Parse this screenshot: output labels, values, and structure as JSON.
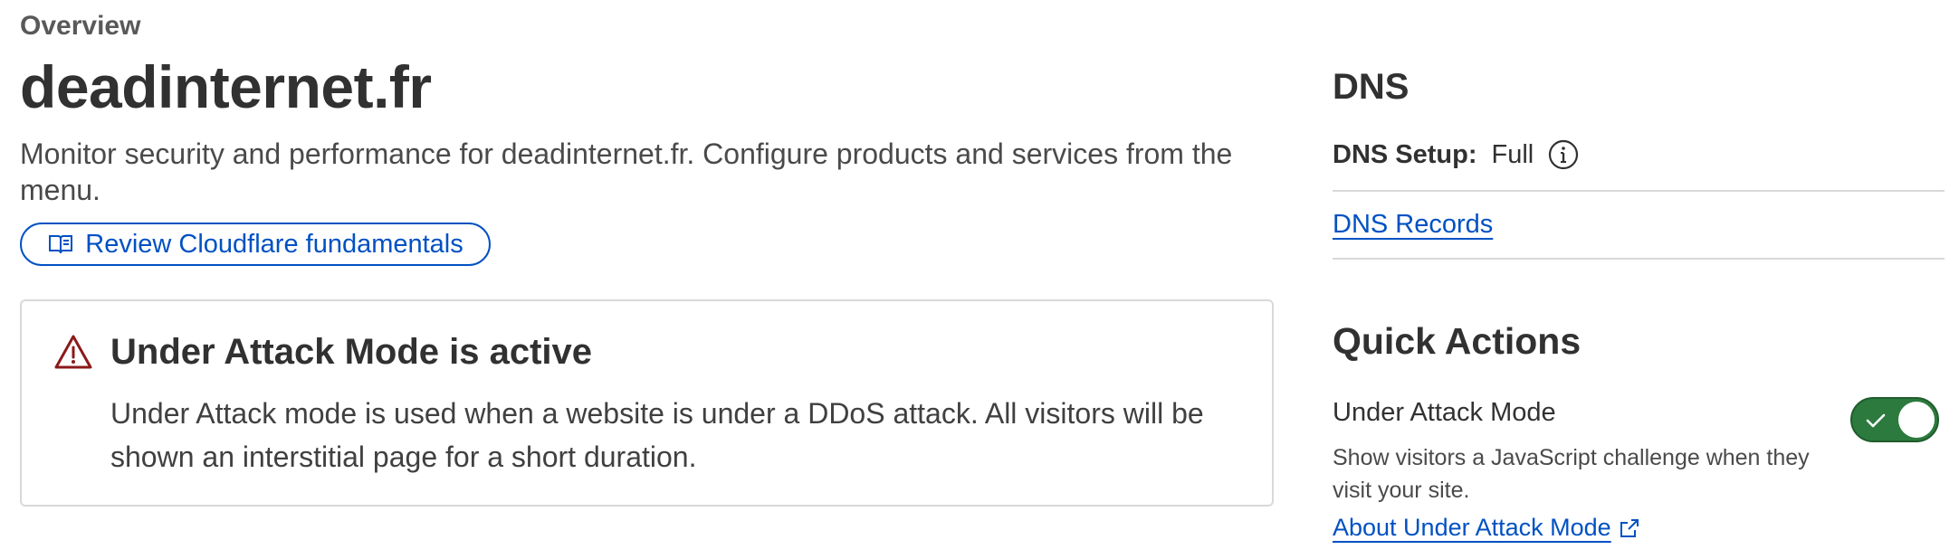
{
  "overview": {
    "eyebrow": "Overview",
    "title": "deadinternet.fr",
    "description": "Monitor security and performance for deadinternet.fr. Configure products and services from the menu.",
    "review_button": {
      "label": "Review Cloudflare fundamentals",
      "icon": "book-icon"
    }
  },
  "alert": {
    "icon": "warning-icon",
    "title": "Under Attack Mode is active",
    "body": "Under Attack mode is used when a website is under a DDoS attack. All visitors will be shown an interstitial page for a short duration."
  },
  "dns": {
    "heading": "DNS",
    "setup_label": "DNS Setup:",
    "setup_value": "Full",
    "info_icon": "info-icon",
    "records_link": "DNS Records"
  },
  "quick_actions": {
    "heading": "Quick Actions",
    "under_attack": {
      "label": "Under Attack Mode",
      "description": "Show visitors a JavaScript challenge when they visit your site.",
      "link": "About Under Attack Mode",
      "link_icon": "external-link-icon",
      "enabled": true
    }
  },
  "colors": {
    "link": "#0051c3",
    "toggle_on": "#2c7a3e",
    "warning": "#8b1a1a",
    "text": "#313131"
  }
}
